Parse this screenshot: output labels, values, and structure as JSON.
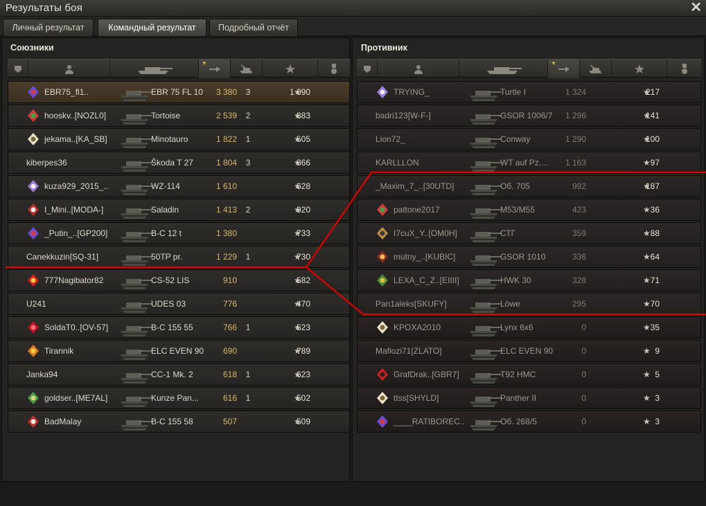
{
  "window": {
    "title": "Результаты боя",
    "close_glyph": "✕"
  },
  "tabs": [
    {
      "label": "Личный результат",
      "active": false
    },
    {
      "label": "Командный результат",
      "active": true
    },
    {
      "label": "Подробный отчёт",
      "active": false
    }
  ],
  "allies": {
    "title": "Союзники",
    "rows": [
      {
        "player": "EBR75_fl1..",
        "vehicle": "EBR 75 FL 10",
        "damage": "3 380",
        "frags": "3",
        "xp": "1 090",
        "emblem": "purple-diamond",
        "me": true
      },
      {
        "player": "hooskv..[NOZL0]",
        "vehicle": "Tortoise",
        "damage": "2 539",
        "frags": "2",
        "xp": "883",
        "emblem": "red-green-badge"
      },
      {
        "player": "jekama..[KA_SB]",
        "vehicle": "Minotauro",
        "damage": "1 822",
        "frags": "1",
        "xp": "505",
        "emblem": "star-badge"
      },
      {
        "player": "kiberpes36",
        "vehicle": "Škoda T 27",
        "damage": "1 804",
        "frags": "3",
        "xp": "866",
        "emblem": ""
      },
      {
        "player": "kuza929_2015_..",
        "vehicle": "WZ-114",
        "damage": "1 610",
        "frags": "",
        "xp": "628",
        "emblem": "skull-badge"
      },
      {
        "player": "I_Mini..[MODA-]",
        "vehicle": "Saladin",
        "damage": "1 413",
        "frags": "2",
        "xp": "920",
        "emblem": "diamond-badge"
      },
      {
        "player": "_Putin_..[GP200]",
        "vehicle": "B-C 12 t",
        "damage": "1 380",
        "frags": "",
        "xp": "733",
        "emblem": "purple-diamond"
      },
      {
        "player": "Canekkuzin[SQ-31]",
        "vehicle": "50TP pr.",
        "damage": "1 229",
        "frags": "1",
        "xp": "730",
        "emblem": ""
      },
      {
        "player": "777Nagibator82",
        "vehicle": "CS-52 LIS",
        "damage": "910",
        "frags": "",
        "xp": "582",
        "emblem": "red-star"
      },
      {
        "player": "U241",
        "vehicle": "UDES 03",
        "damage": "776",
        "frags": "",
        "xp": "470",
        "emblem": ""
      },
      {
        "player": "SoldaT0..[OV-57]",
        "vehicle": "B-C 155 55",
        "damage": "766",
        "frags": "1",
        "xp": "523",
        "emblem": "red-circle"
      },
      {
        "player": "Tirannik",
        "vehicle": "ELC EVEN 90",
        "damage": "690",
        "frags": "",
        "xp": "789",
        "emblem": "orange-badge"
      },
      {
        "player": "Janka94",
        "vehicle": "CC-1 Mk. 2",
        "damage": "618",
        "frags": "1",
        "xp": "623",
        "emblem": ""
      },
      {
        "player": "goldser..[ME7AL]",
        "vehicle": "Kunze Pan...",
        "damage": "616",
        "frags": "1",
        "xp": "502",
        "emblem": "green-badge"
      },
      {
        "player": "BadMalay",
        "vehicle": "B-C 155 58",
        "damage": "507",
        "frags": "",
        "xp": "509",
        "emblem": "diamond-badge"
      }
    ]
  },
  "enemies": {
    "title": "Противник",
    "rows": [
      {
        "player": "TRYING_",
        "vehicle": "Turtle I",
        "damage": "1 324",
        "xp": "217",
        "emblem": "skull-badge"
      },
      {
        "player": "badri123[W-F-]",
        "vehicle": "GSOR 1006/7",
        "damage": "1 296",
        "xp": "141",
        "emblem": ""
      },
      {
        "player": "Lion72_",
        "vehicle": "Conway",
        "damage": "1 290",
        "xp": "100",
        "emblem": ""
      },
      {
        "player": "KARLLLON",
        "vehicle": "WT auf Pz....",
        "damage": "1 163",
        "xp": "97",
        "emblem": ""
      },
      {
        "player": "_Maxim_7_..[30UTD]",
        "vehicle": "Об. 705",
        "damage": "992",
        "xp": "187",
        "emblem": ""
      },
      {
        "player": "pattone2017",
        "vehicle": "M53/M55",
        "damage": "423",
        "xp": "36",
        "emblem": "red-green-badge"
      },
      {
        "player": "I7cuX_Y..[OM0H]",
        "vehicle": "СТГ",
        "damage": "359",
        "xp": "88",
        "emblem": "target-badge"
      },
      {
        "player": "mutny_..[KUBIC]",
        "vehicle": "GSOR 1010",
        "damage": "336",
        "xp": "64",
        "emblem": "b-badge"
      },
      {
        "player": "LEXA_C_Z..[EIIII]",
        "vehicle": "HWK 30",
        "damage": "328",
        "xp": "71",
        "emblem": "shield-badge"
      },
      {
        "player": "Pan1aleks[SKUFY]",
        "vehicle": "Löwe",
        "damage": "295",
        "xp": "70",
        "emblem": ""
      },
      {
        "player": "KPOXA2010",
        "vehicle": "Lynx 6x6",
        "damage": "0",
        "xp": "35",
        "emblem": "star-badge"
      },
      {
        "player": "Mafiozi71[ZLATO]",
        "vehicle": "ELC EVEN 90",
        "damage": "0",
        "xp": "9",
        "emblem": ""
      },
      {
        "player": "GrafDrak..[GBR7]",
        "vehicle": "T92 HMC",
        "damage": "0",
        "xp": "5",
        "emblem": "red-eye-badge"
      },
      {
        "player": "ttss[SHYLD]",
        "vehicle": "Panther II",
        "damage": "0",
        "xp": "3",
        "emblem": "star-badge"
      },
      {
        "player": "____RATIBOREC..",
        "vehicle": "Об. 268/5",
        "damage": "0",
        "xp": "3",
        "emblem": "purple-diamond"
      }
    ]
  },
  "colors": {
    "accent_gold": "#d9b66c",
    "annotation_line": "#e00000"
  }
}
